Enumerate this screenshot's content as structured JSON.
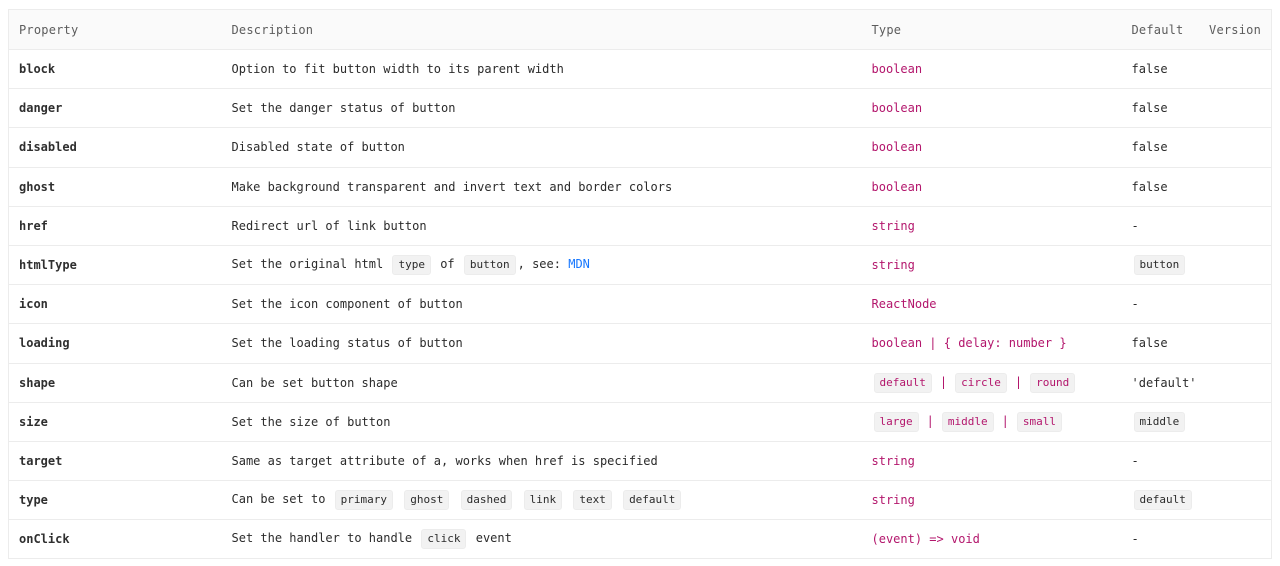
{
  "header": {
    "property": "Property",
    "description": "Description",
    "type": "Type",
    "default": "Default",
    "version": "Version"
  },
  "rows": [
    {
      "property": "block",
      "description": "Option to fit button width to its parent width",
      "type": "boolean",
      "default": "false"
    },
    {
      "property": "danger",
      "description": "Set the danger status of button",
      "type": "boolean",
      "default": "false"
    },
    {
      "property": "disabled",
      "description": "Disabled state of button",
      "type": "boolean",
      "default": "false"
    },
    {
      "property": "ghost",
      "description": "Make background transparent and invert text and border colors",
      "type": "boolean",
      "default": "false"
    },
    {
      "property": "href",
      "description": "Redirect url of link button",
      "type": "string",
      "default": "-"
    },
    {
      "property": "htmlType",
      "description_parts": [
        "Set the original html",
        "type",
        "of",
        "button",
        ", see:",
        "MDN"
      ],
      "type": "string",
      "default_code": "button"
    },
    {
      "property": "icon",
      "description": "Set the icon component of button",
      "type": "ReactNode",
      "default": "-"
    },
    {
      "property": "loading",
      "description": "Set the loading status of button",
      "type": "boolean | { delay: number }",
      "default": "false"
    },
    {
      "property": "shape",
      "description": "Can be set button shape",
      "type_codes": [
        "default",
        "circle",
        "round"
      ],
      "type_sep": "|",
      "default": "'default'"
    },
    {
      "property": "size",
      "description": "Set the size of button",
      "type_codes": [
        "large",
        "middle",
        "small"
      ],
      "type_sep": "|",
      "default_code": "middle"
    },
    {
      "property": "target",
      "description": "Same as target attribute of a, works when href is specified",
      "type": "string",
      "default": "-"
    },
    {
      "property": "type",
      "description_prefix": "Can be set to",
      "description_codes": [
        "primary",
        "ghost",
        "dashed",
        "link",
        "text",
        "default"
      ],
      "type": "string",
      "default_code": "default"
    },
    {
      "property": "onClick",
      "description_parts": [
        "Set the handler to handle",
        "click",
        "event"
      ],
      "type": "(event) => void",
      "default": "-"
    }
  ],
  "colors": {
    "type_text": "#b3166c",
    "link": "#1677ff",
    "header_bg": "#fafafa",
    "border": "#ececec"
  }
}
